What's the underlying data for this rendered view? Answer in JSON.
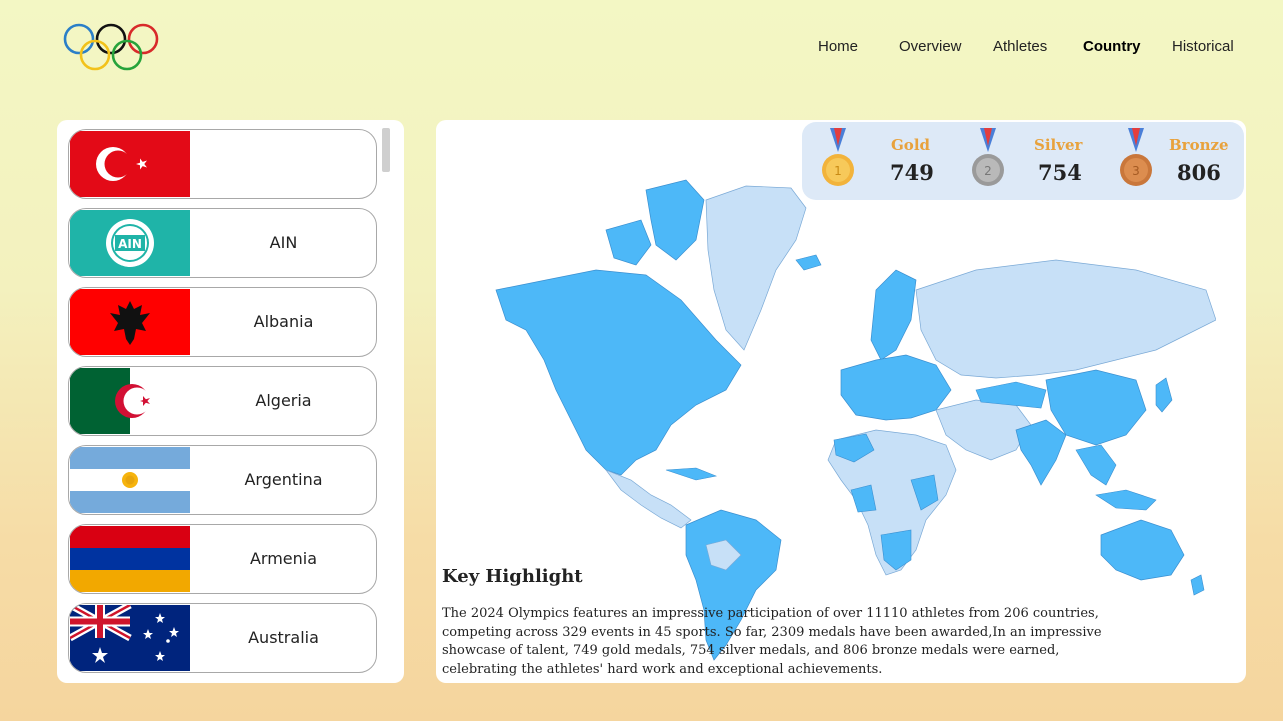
{
  "nav": {
    "items": [
      {
        "label": "Home"
      },
      {
        "label": "Overview"
      },
      {
        "label": "Athletes"
      },
      {
        "label": "Country",
        "active": true
      },
      {
        "label": "Historical"
      }
    ]
  },
  "countries": [
    {
      "name": "",
      "flag": "turkey-flag-icon"
    },
    {
      "name": "AIN",
      "flag": "ain-flag-icon",
      "flag_text": "AIN"
    },
    {
      "name": "Albania",
      "flag": "albania-flag-icon"
    },
    {
      "name": "Algeria",
      "flag": "algeria-flag-icon"
    },
    {
      "name": "Argentina",
      "flag": "argentina-flag-icon"
    },
    {
      "name": "Armenia",
      "flag": "armenia-flag-icon"
    },
    {
      "name": "Australia",
      "flag": "australia-flag-icon"
    }
  ],
  "medals": {
    "gold": {
      "label": "Gold",
      "value": "749",
      "icon": "gold-medal-icon"
    },
    "silver": {
      "label": "Silver",
      "value": "754",
      "icon": "silver-medal-icon"
    },
    "bronze": {
      "label": "Bronze",
      "value": "806",
      "icon": "bronze-medal-icon"
    }
  },
  "highlight": {
    "title": "Key Highlight",
    "text": "The 2024 Olympics features an impressive participation of over 11110 athletes from 206 countries, competing across 329 events in 45 sports. So far, 2309 medals have been awarded,In an impressive showcase of talent, 749 gold medals, 754 silver medals, and 806 bronze medals were earned, celebrating the athletes' hard work and exceptional achievements."
  },
  "colors": {
    "map_participating": "#4db8f8",
    "map_other": "#c7e0f7",
    "medal_label": "#e8a23d"
  }
}
